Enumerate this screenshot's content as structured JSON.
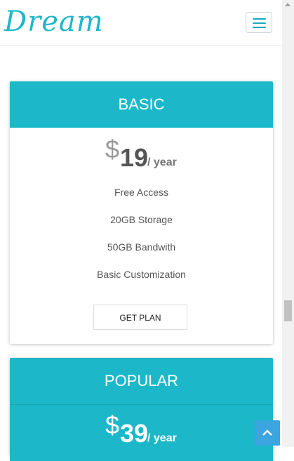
{
  "header": {
    "logo_text": "Dream"
  },
  "plans": [
    {
      "name": "BASIC",
      "currency": "$",
      "amount": "19",
      "period": "/ year",
      "features": [
        "Free Access",
        "20GB Storage",
        "50GB Bandwith",
        "Basic Customization"
      ],
      "button_label": "GET PLAN"
    },
    {
      "name": "POPULAR",
      "currency": "$",
      "amount": "39",
      "period": "/ year"
    }
  ],
  "colors": {
    "accent": "#1cb8c9",
    "back_to_top": "#3ca4df"
  },
  "icons": {
    "menu": "hamburger-icon",
    "back_to_top": "chevron-up-icon"
  }
}
